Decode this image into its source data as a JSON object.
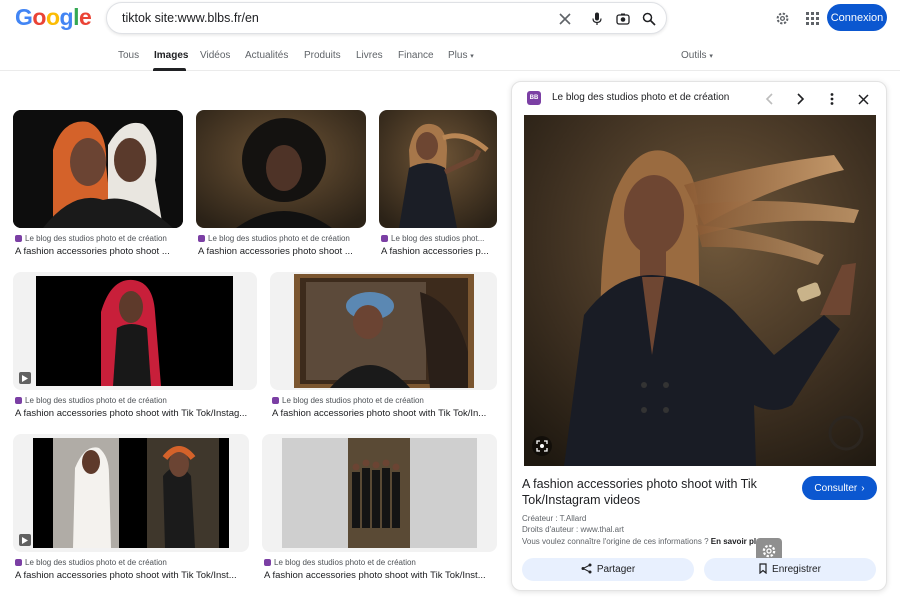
{
  "header": {
    "logo_letters": [
      {
        "char": "G",
        "color": "#4285F4"
      },
      {
        "char": "o",
        "color": "#EA4335"
      },
      {
        "char": "o",
        "color": "#FBBC05"
      },
      {
        "char": "g",
        "color": "#4285F4"
      },
      {
        "char": "l",
        "color": "#34A853"
      },
      {
        "char": "e",
        "color": "#EA4335"
      }
    ],
    "search_query": "tiktok site:www.blbs.fr/en",
    "signin_label": "Connexion"
  },
  "tabs": {
    "items": [
      "Tous",
      "Images",
      "Vidéos",
      "Actualités",
      "Produits",
      "Livres",
      "Finance",
      "Plus"
    ],
    "active": "Images",
    "tools_label": "Outils"
  },
  "results": [
    {
      "source": "Le blog des studios photo et de création",
      "title": "A fashion accessories photo shoot ...",
      "video": false
    },
    {
      "source": "Le blog des studios photo et de création",
      "title": "A fashion accessories photo shoot ...",
      "video": false
    },
    {
      "source": "Le blog des studios phot...",
      "title": "A fashion accessories p...",
      "video": false
    },
    {
      "source": "Le blog des studios photo et de création",
      "title": "A fashion accessories photo shoot with Tik Tok/Instag...",
      "video": true
    },
    {
      "source": "Le blog des studios photo et de création",
      "title": "A fashion accessories photo shoot with Tik Tok/In...",
      "video": false
    },
    {
      "source": "Le blog des studios photo et de création",
      "title": "A fashion accessories photo shoot with Tik Tok/Inst...",
      "video": true
    },
    {
      "source": "Le blog des studios photo et de création",
      "title": "A fashion accessories photo shoot with Tik Tok/Inst...",
      "video": true
    }
  ],
  "panel": {
    "site_name": "Le blog des studios photo et de création",
    "favicon_text": "BB",
    "title": "A fashion accessories photo shoot with Tik Tok/Instagram videos",
    "visit_label": "Consulter",
    "creator_label": "Créateur : T.Allard",
    "copyright_label": "Droits d'auteur : www.thal.art",
    "origin_question": "Vous voulez connaître l'origine de ces informations ?",
    "learn_more": "En savoir plus",
    "share_label": "Partager",
    "save_label": "Enregistrer"
  },
  "colors": {
    "accent_blue": "#0b57d0",
    "favicon_purple": "#7b3fa4",
    "button_light": "#e8f0fe"
  }
}
